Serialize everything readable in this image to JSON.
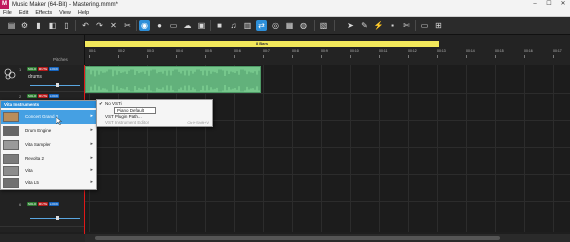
{
  "window": {
    "title": "Music Maker (64-Bit) - Mastering.mmm*",
    "logo": "M",
    "min": "–",
    "max": "☐",
    "close": "✕"
  },
  "menu": [
    "File",
    "Edit",
    "Effects",
    "View",
    "Help"
  ],
  "toolbar_icons": [
    "save-icon",
    "settings-icon",
    "undo-icon",
    "redo-icon",
    "delete-icon",
    "cut-icon",
    "snap-icon",
    "record-icon",
    "folder-icon",
    "upload-icon",
    "store-icon",
    "music-note-icon",
    "piano-icon",
    "loop-icon",
    "mixer-icon",
    "midi-icon",
    "square-icon",
    "cursor-icon",
    "tool-icon",
    "knife-icon",
    "lock-icon",
    "screen-icon",
    "zoom-icon"
  ],
  "header": {
    "pitches": "Pitches"
  },
  "timeline": {
    "loop_label": "8 Bars",
    "ruler": [
      "00:1",
      "00:2",
      "00:3",
      "00:4",
      "00:5",
      "00:6",
      "00:7",
      "00:8",
      "00:9",
      "00:10",
      "00:11",
      "00:12",
      "00:13",
      "00:14",
      "00:15",
      "00:16",
      "00:17"
    ]
  },
  "tracks": [
    {
      "num": "1",
      "name": "drums",
      "buttons": [
        "SOLO",
        "MUTE",
        "LOCK"
      ]
    },
    {
      "num": "2",
      "name": "",
      "buttons": [
        "SOLO",
        "MUTE",
        "LOCK"
      ]
    },
    {
      "num": "3",
      "name": "",
      "buttons": []
    },
    {
      "num": "4",
      "name": "",
      "buttons": []
    },
    {
      "num": "5",
      "name": "",
      "buttons": []
    },
    {
      "num": "6",
      "name": "",
      "buttons": [
        "SOLO",
        "MUTE",
        "LOCK"
      ]
    }
  ],
  "context_menu": {
    "header": "Vita Instruments",
    "items": [
      "Concert Grand 2",
      "Drum Engine",
      "Vita Sampler",
      "Revolta 2",
      "Vita",
      "Vita L5"
    ]
  },
  "submenu": {
    "items": [
      {
        "label": "No VSTi",
        "check": "✔",
        "shortcut": "",
        "dim": false
      },
      {
        "label": "Piano Default",
        "check": "",
        "shortcut": "",
        "dim": false
      },
      {
        "label": "VST Plugin Path...",
        "check": "",
        "shortcut": "",
        "dim": false
      },
      {
        "label": "VST Instrument Editor",
        "check": "",
        "shortcut": "Ctrl+Shift+V",
        "dim": true
      }
    ],
    "tooltip": "Piano Default"
  },
  "colors": {
    "accent": "#2d8fd9",
    "clip": "#76c78c",
    "loop": "#f2e85b",
    "playhead": "#e01818"
  }
}
